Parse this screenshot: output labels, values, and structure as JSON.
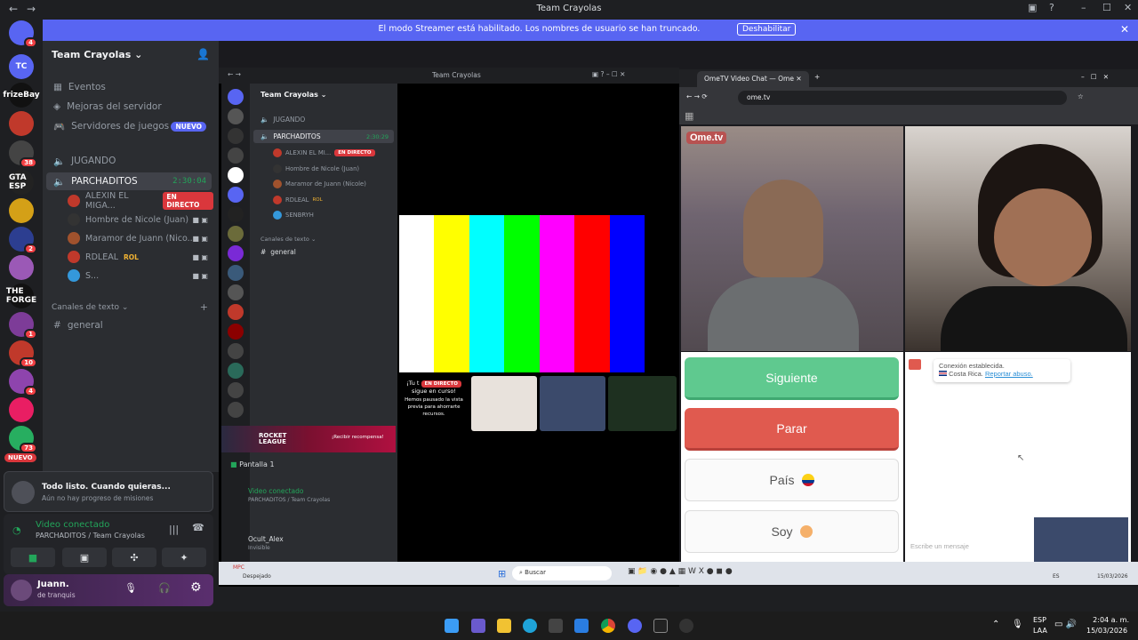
{
  "window": {
    "title": "Team Crayolas"
  },
  "banner": {
    "message": "El modo Streamer está habilitado. Los nombres de usuario se han truncado.",
    "button": "Deshabilitar"
  },
  "guilds": [
    {
      "label": "",
      "color": "#5865f2",
      "badge": "4"
    },
    {
      "label": "TC",
      "color": "#5865f2",
      "badge": ""
    },
    {
      "label": "frizeBay",
      "color": "#111",
      "badge": ""
    },
    {
      "label": "",
      "color": "#c0392b",
      "badge": ""
    },
    {
      "label": "",
      "color": "#444",
      "badge": "38"
    },
    {
      "label": "GTA ESP",
      "color": "#222",
      "badge": ""
    },
    {
      "label": "",
      "color": "#d4a017",
      "badge": ""
    },
    {
      "label": "",
      "color": "#2c3e90",
      "badge": "2"
    },
    {
      "label": "",
      "color": "#9b59b6",
      "badge": ""
    },
    {
      "label": "THE FORGE",
      "color": "#111",
      "badge": ""
    },
    {
      "label": "",
      "color": "#7d3c98",
      "badge": "1"
    },
    {
      "label": "",
      "color": "#c0392b",
      "badge": "10"
    },
    {
      "label": "",
      "color": "#8e44ad",
      "badge": "4"
    },
    {
      "label": "",
      "color": "#e91e63",
      "badge": ""
    },
    {
      "label": "",
      "color": "#27ae60",
      "badge": "73"
    }
  ],
  "guild_new": "NUEVO",
  "sidebar": {
    "server": "Team Crayolas",
    "items": [
      {
        "label": "Eventos"
      },
      {
        "label": "Mejoras del servidor"
      },
      {
        "label": "Servidores de juegos",
        "pill": "NUEVO"
      }
    ],
    "voice1": "JUGANDO",
    "voice2": "PARCHADITOS",
    "voice2_time": "2:30:04",
    "users": [
      {
        "name": "ALEXIN EL MIGA...",
        "live": "EN DIRECTO",
        "color": "#c0392b"
      },
      {
        "name": "Hombre de Nicole (Juan)",
        "live": "",
        "color": "#333"
      },
      {
        "name": "Maramor de Juann (Nico...",
        "live": "",
        "color": "#a0522d"
      },
      {
        "name": "RDLEAL",
        "live": "",
        "role": "ROL",
        "color": "#c0392b"
      },
      {
        "name": "S...",
        "live": "",
        "color": "#3498db"
      }
    ],
    "text_category": "Canales de texto",
    "text_channel": "general"
  },
  "quest": {
    "title": "Todo listo. Cuando quieras...",
    "subtitle": "Aún no hay progreso de misiones"
  },
  "voice_panel": {
    "status": "Video conectado",
    "channel": "PARCHADITOS / Team Crayolas"
  },
  "user": {
    "name": "Juann.",
    "status": "de tranquis"
  },
  "stream_window": {
    "title": "Team Crayolas",
    "server": "Team Crayolas",
    "voice1": "JUGANDO",
    "voice2": "PARCHADITOS",
    "voice2_time": "2:30:29",
    "users": [
      {
        "name": "ALEXIN EL MI...",
        "live": "EN DIRECTO",
        "color": "#c0392b"
      },
      {
        "name": "Hombre de Nicole (Juan)",
        "live": "",
        "color": "#333"
      },
      {
        "name": "Maramor de Juann (Nicole)",
        "live": "",
        "color": "#a0522d"
      },
      {
        "name": "RDLEAL",
        "live": "",
        "role": "ROL",
        "color": "#c0392b"
      },
      {
        "name": "SENBRYH",
        "live": "",
        "color": "#3498db"
      }
    ],
    "text_category": "Canales de texto",
    "text_channel": "general",
    "promo_game": "ROCKET LEAGUE",
    "promo_button": "¡Recibir recompensa!",
    "screen": "Pantalla 1",
    "video_status": "Video conectado",
    "video_channel": "PARCHADITOS / Team Crayolas",
    "user": "Ocult_Alex",
    "user_status": "Invisible",
    "preview_live": "EN DIRECTO",
    "preview_msg": "¡Tu t  sigue en curso! Hemos pausado la vista previa para ahorrarte recursos.",
    "preview_msg_a": "¡Tu t",
    "preview_msg_b": "sigue en curso!",
    "preview_msg_c": "Hemos pausado la vista previa para ahorrarte recursos.",
    "bars": [
      "#ffffff",
      "#ffff00",
      "#00ffff",
      "#00ff00",
      "#ff00ff",
      "#ff0000",
      "#0000ff"
    ]
  },
  "ome": {
    "tab": "OmeTV Video Chat — Ome",
    "url": "ome.tv",
    "logo": "Ome.tv",
    "next": "Siguiente",
    "stop": "Parar",
    "country": "País",
    "me": "Soy",
    "chat_status": "Conexión establecida.",
    "chat_country": "Costa Rica.",
    "chat_report": "Reportar abuso.",
    "chat_placeholder": "Escribe un mensaje"
  },
  "inner_taskbar": {
    "weather": "Despejado",
    "weather_temp": "MPC",
    "search": "Buscar",
    "time": "15/03/2026",
    "lang": "ES"
  },
  "taskbar": {
    "lang": "ESP",
    "lang2": "LAA",
    "time": "2:04 a. m.",
    "date": "15/03/2026"
  }
}
